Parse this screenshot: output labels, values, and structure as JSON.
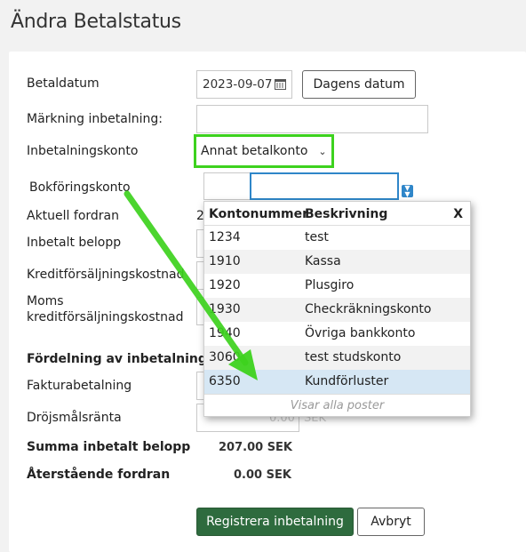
{
  "page": {
    "title": "Ändra Betalstatus"
  },
  "form": {
    "betaldatum_label": "Betaldatum",
    "betaldatum_value": "2023-09-07",
    "dagens_datum_button": "Dagens datum",
    "markning_label": "Märkning inbetalning:",
    "markning_value": "",
    "inbetalningskonto_label": "Inbetalningskonto",
    "inbetalningskonto_value": "Annat betalkonto",
    "bokforingskonto_label": "Bokföringskonto",
    "bokforingskonto_value": "",
    "aktuell_fordran_label": "Aktuell fordran",
    "aktuell_fordran_partial": "2",
    "inbetalt_belopp_label": "Inbetalt belopp",
    "kreditforsaljning_label": "Kreditförsäljningskostnad",
    "moms_line1": "Moms",
    "moms_line2": "kreditförsäljningskostnad",
    "fordelning_label": "Fördelning av inbetalning",
    "fakturabetalning_label": "Fakturabetalning",
    "drojsmalsranta_label": "Dröjsmålsränta",
    "drojsmalsranta_behind": "0.00",
    "drojsmalsranta_unit_behind": "SEK",
    "summa_label": "Summa inbetalt belopp",
    "summa_value": "207.00 SEK",
    "aterstaende_label": "Återstående fordran",
    "aterstaende_value": "0.00 SEK",
    "register_button": "Registrera inbetalning",
    "cancel_button": "Avbryt"
  },
  "dropdown": {
    "header_kontonummer": "Kontonummer",
    "header_beskrivning": "Beskrivning",
    "close": "X",
    "rows": [
      {
        "nummer": "1234",
        "beskrivning": "test"
      },
      {
        "nummer": "1910",
        "beskrivning": "Kassa"
      },
      {
        "nummer": "1920",
        "beskrivning": "Plusgiro"
      },
      {
        "nummer": "1930",
        "beskrivning": "Checkräkningskonto"
      },
      {
        "nummer": "1940",
        "beskrivning": "Övriga bankkonto"
      },
      {
        "nummer": "3060",
        "beskrivning": "test studskonto"
      },
      {
        "nummer": "6350",
        "beskrivning": "Kundförluster"
      }
    ],
    "footer": "Visar alla poster"
  },
  "colors": {
    "highlight": "#3dd21e",
    "primary_button": "#2e6b3e",
    "focus": "#2f86c9",
    "selected_row": "#d6e7f4"
  },
  "icons": {
    "date_picker": "calendar-icon",
    "dropdown_chevron": "chevron-down-icon",
    "account_lookup": "lookup-icon",
    "annotation": "arrow-annotation"
  }
}
